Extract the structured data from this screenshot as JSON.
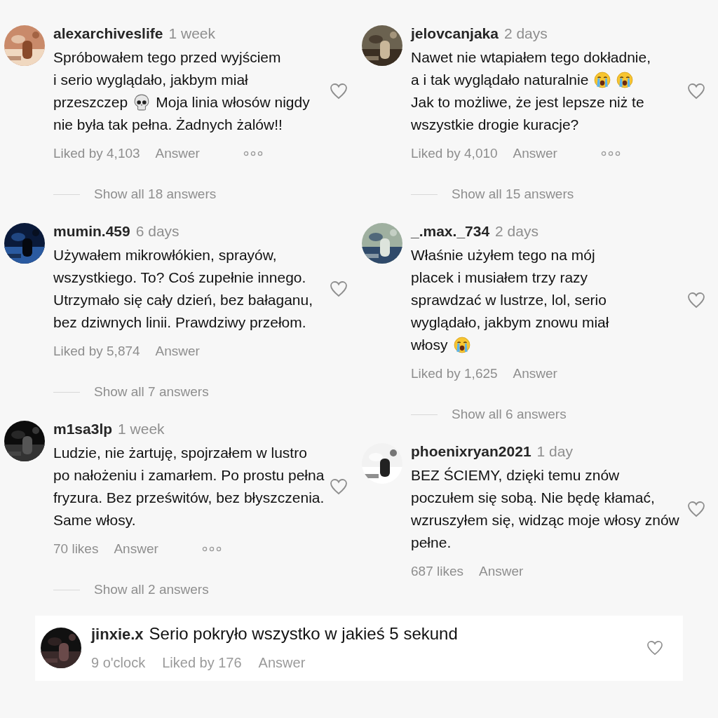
{
  "columns": [
    {
      "comments": [
        {
          "username": "alexarchiveslife",
          "time": "1 week",
          "lines": [
            [
              {
                "kind": "text",
                "text": "Spróbowałem tego przed wyjściem"
              }
            ],
            [
              {
                "kind": "text",
                "text": "i serio wyglądało, jakbym miał"
              }
            ],
            [
              {
                "kind": "text",
                "text": "przeszczep"
              },
              {
                "kind": "skull"
              },
              {
                "kind": "text",
                "text": "Moja linia włosów nigdy"
              }
            ],
            [
              {
                "kind": "text",
                "text": "nie była tak pełna. Żadnych żalów!!"
              }
            ]
          ],
          "likes": "Liked by 4,103",
          "answer": "Answer",
          "more": true,
          "show_all": "Show all 18 answers"
        },
        {
          "username": "mumin.459",
          "time": "6 days",
          "body": [
            {
              "kind": "text",
              "text": "Używałem mikrowłókien, sprayów, wszystkiego. To? Coś zupełnie innego. Utrzymało się cały dzień, bez bałaganu, bez dziwnych linii. Prawdziwy przełom."
            }
          ],
          "likes": "Liked by 5,874",
          "answer": "Answer",
          "more": false,
          "show_all": "Show all 7 answers"
        },
        {
          "username": "m1sa3lp",
          "time": "1 week",
          "body": [
            {
              "kind": "text",
              "text": "Ludzie, nie żartuję, spojrzałem w lustro po nałożeniu i zamarłem. Po prostu pełna fryzura. Bez prześwitów, bez błyszczenia. Same włosy."
            }
          ],
          "likes": "70 likes",
          "answer": "Answer",
          "more": true,
          "show_all": "Show all 2 answers"
        }
      ]
    },
    {
      "comments": [
        {
          "username": "jelovcanjaka",
          "time": "2 days",
          "lines": [
            [
              {
                "kind": "text",
                "text": "Nawet nie wtapiałem tego dokładnie,"
              }
            ],
            [
              {
                "kind": "text",
                "text": "a i tak wyglądało naturalnie"
              },
              {
                "kind": "crying"
              },
              {
                "kind": "crying"
              }
            ],
            [
              {
                "kind": "text",
                "text": "Jak to możliwe, że jest lepsze niż te"
              }
            ],
            [
              {
                "kind": "text",
                "text": "wszystkie drogie kuracje?"
              }
            ]
          ],
          "likes": "Liked by 4,010",
          "answer": "Answer",
          "more": true,
          "show_all": "Show all 15 answers"
        },
        {
          "username": "_.max._734",
          "time": "2 days",
          "lines": [
            [
              {
                "kind": "text",
                "text": "Właśnie użyłem tego na mój"
              }
            ],
            [
              {
                "kind": "text",
                "text": "placek i musiałem trzy razy"
              }
            ],
            [
              {
                "kind": "text",
                "text": "sprawdzać w lustrze, lol, serio"
              }
            ],
            [
              {
                "kind": "text",
                "text": "wyglądało, jakbym znowu miał"
              }
            ],
            [
              {
                "kind": "text",
                "text": "włosy"
              },
              {
                "kind": "crying"
              }
            ]
          ],
          "likes": "Liked by 1,625",
          "answer": "Answer",
          "more": false,
          "show_all": "Show all 6 answers"
        },
        {
          "username": "phoenixryan2021",
          "time": "1 day",
          "body": [
            {
              "kind": "text",
              "text": "BEZ ŚCIEMY, dzięki temu znów poczułem się sobą. Nie będę kłamać, wzruszyłem się, widząc moje włosy znów pełne."
            }
          ],
          "likes": "687 likes",
          "answer": "Answer",
          "more": false
        }
      ]
    }
  ],
  "featured": {
    "username": "jinxie.x",
    "text": "Serio pokryło wszystko w jakieś 5 sekund",
    "time": "9 o'clock",
    "likes": "Liked by 176",
    "answer": "Answer"
  }
}
